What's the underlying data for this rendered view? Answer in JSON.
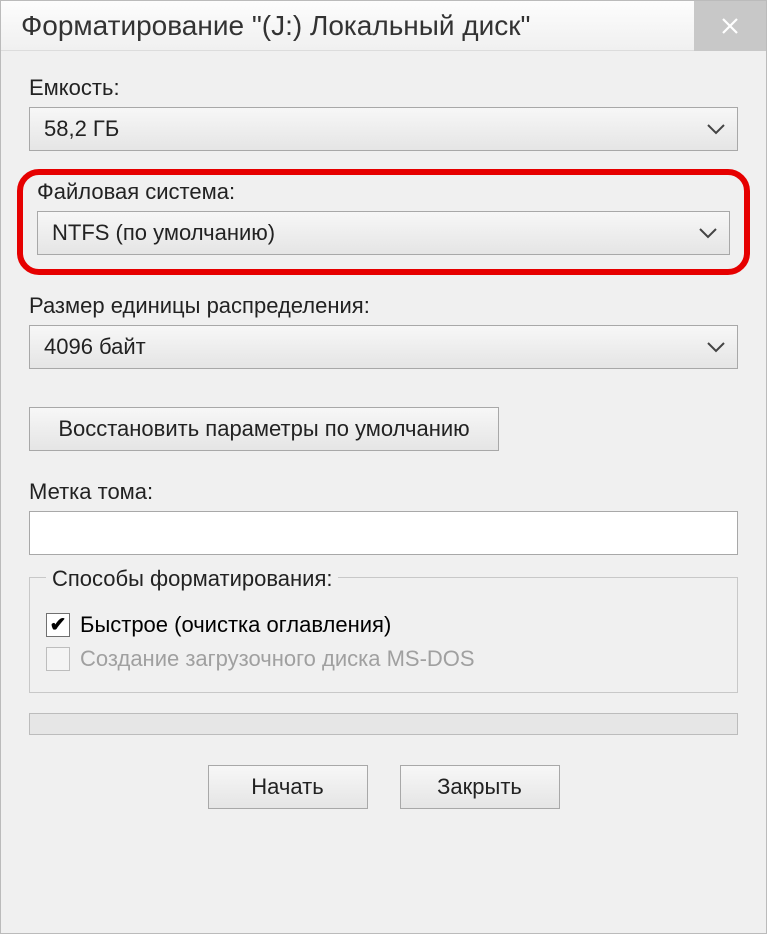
{
  "window": {
    "title": "Форматирование \"(J:) Локальный диск\""
  },
  "capacity": {
    "label": "Емкость:",
    "value": "58,2 ГБ"
  },
  "filesystem": {
    "label": "Файловая система:",
    "value": "NTFS (по умолчанию)"
  },
  "allocation": {
    "label": "Размер единицы распределения:",
    "value": "4096 байт"
  },
  "restore_defaults_label": "Восстановить параметры по умолчанию",
  "volume_label": {
    "label": "Метка тома:",
    "value": ""
  },
  "options": {
    "legend": "Способы форматирования:",
    "quick_label": "Быстрое (очистка оглавления)",
    "quick_checked": true,
    "msdos_label": "Создание загрузочного диска MS-DOS",
    "msdos_checked": false,
    "msdos_enabled": false
  },
  "buttons": {
    "start": "Начать",
    "close": "Закрыть"
  }
}
